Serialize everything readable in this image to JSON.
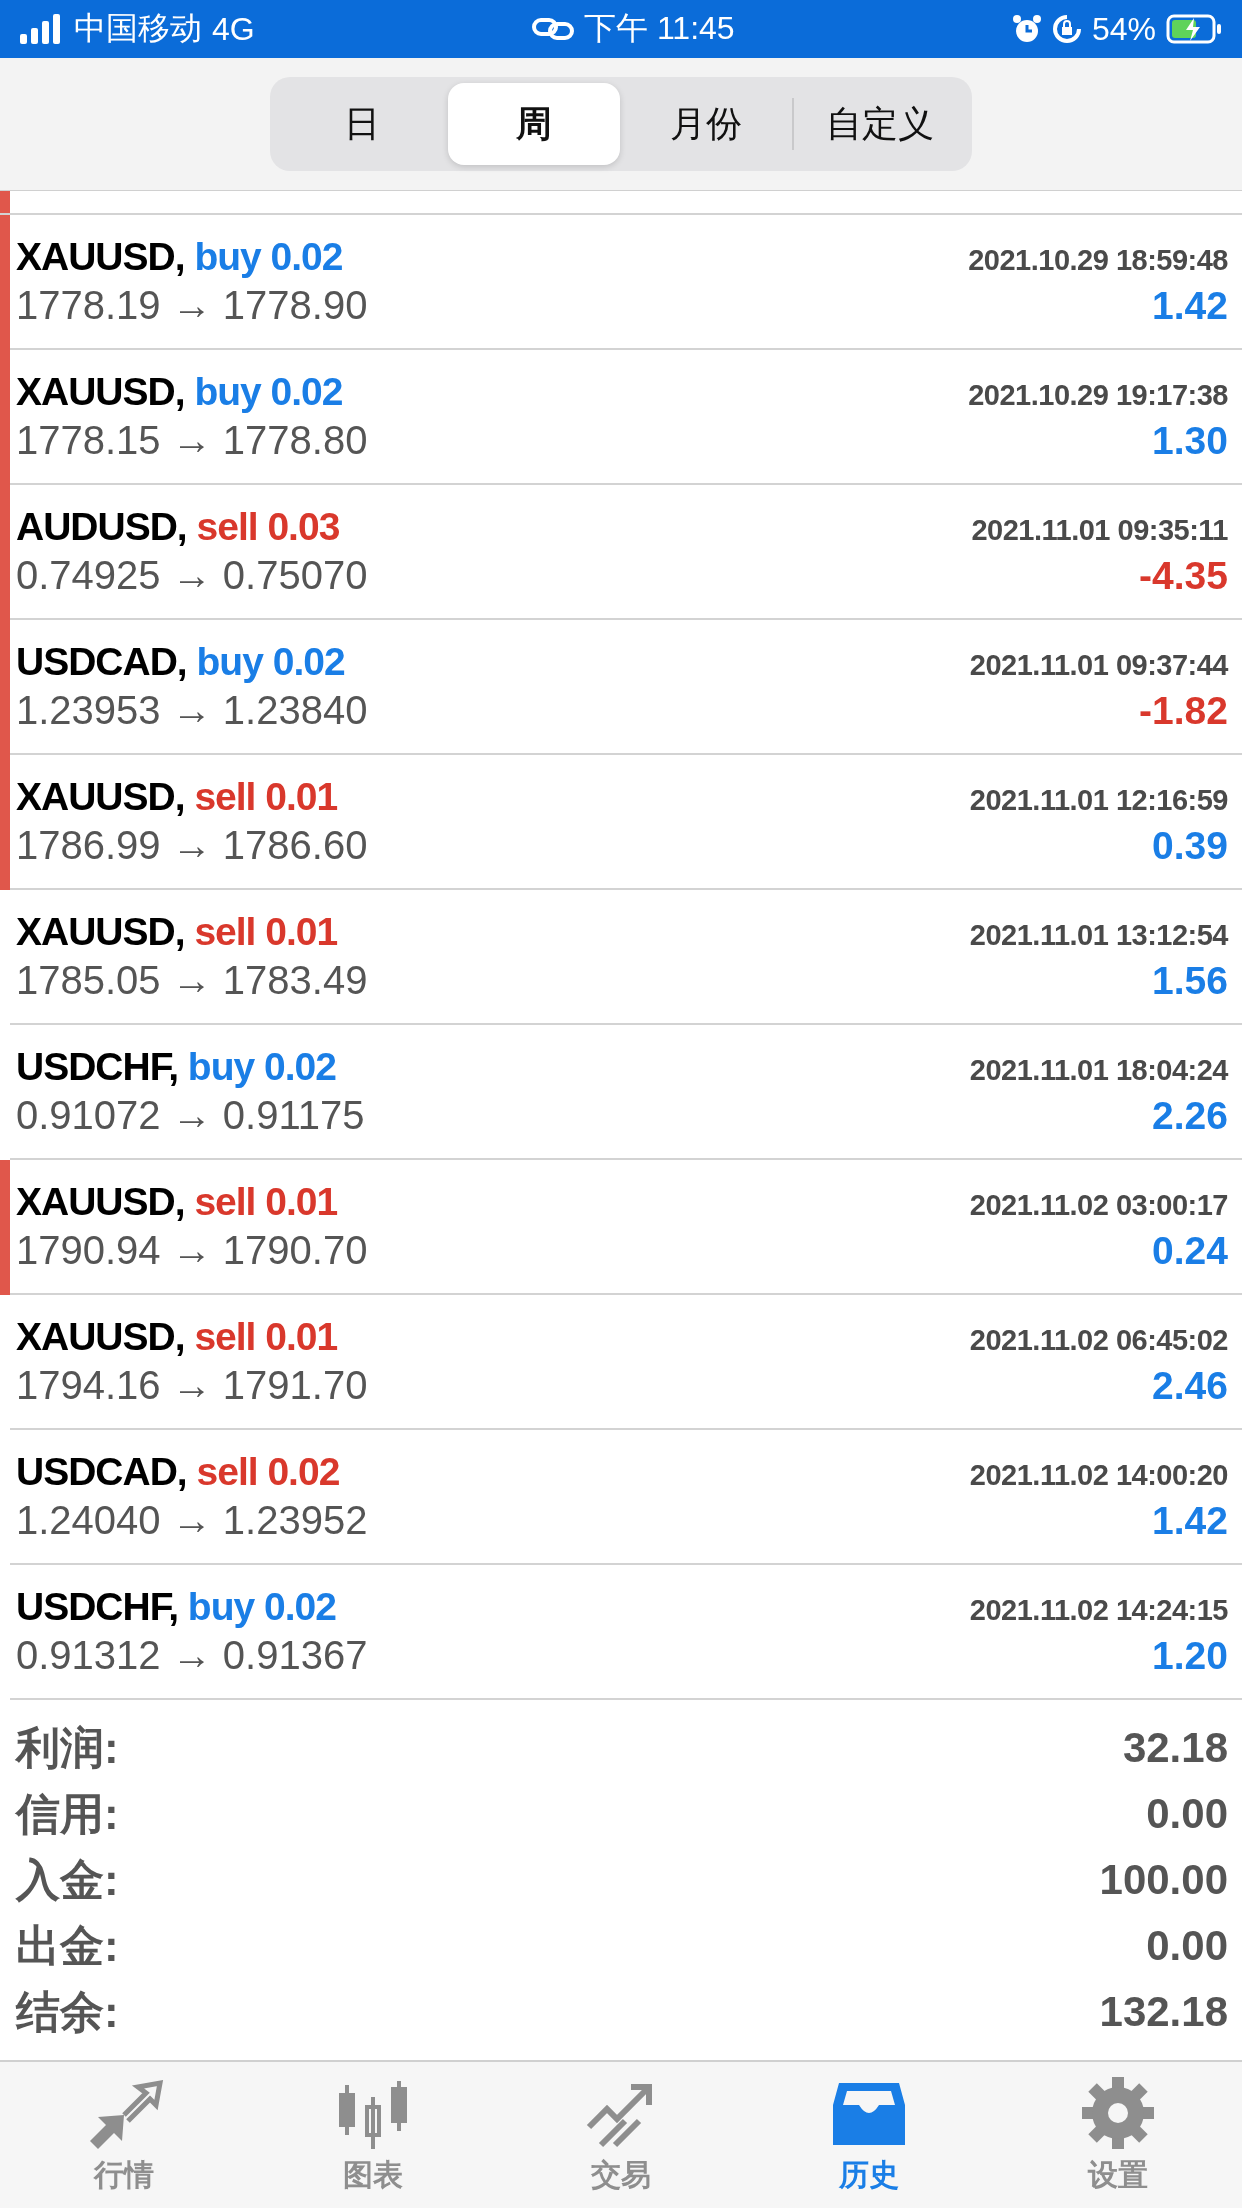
{
  "status_bar": {
    "carrier": "中国移动",
    "network": "4G",
    "time": "下午 11:45",
    "battery": "54%"
  },
  "period_tabs": [
    {
      "label": "日",
      "selected": false
    },
    {
      "label": "周",
      "selected": true
    },
    {
      "label": "月份",
      "selected": false
    },
    {
      "label": "自定义",
      "selected": false
    }
  ],
  "partial_row": {
    "marked": true
  },
  "trades": [
    {
      "symbol": "XAUUSD,",
      "side": {
        "text": "buy",
        "color": "#1a7ee6"
      },
      "volume": "0.02",
      "time": "2021.10.29 18:59:48",
      "prices": "1778.19 → 1778.90",
      "profit": {
        "text": "1.42",
        "color": "#1a7ee6"
      },
      "marked": true
    },
    {
      "symbol": "XAUUSD,",
      "side": {
        "text": "buy",
        "color": "#1a7ee6"
      },
      "volume": "0.02",
      "time": "2021.10.29 19:17:38",
      "prices": "1778.15 → 1778.80",
      "profit": {
        "text": "1.30",
        "color": "#1a7ee6"
      },
      "marked": true
    },
    {
      "symbol": "AUDUSD,",
      "side": {
        "text": "sell",
        "color": "#d9382c"
      },
      "volume": "0.03",
      "time": "2021.11.01 09:35:11",
      "prices": "0.74925 → 0.75070",
      "profit": {
        "text": "-4.35",
        "color": "#d9382c"
      },
      "marked": true
    },
    {
      "symbol": "USDCAD,",
      "side": {
        "text": "buy",
        "color": "#1a7ee6"
      },
      "volume": "0.02",
      "time": "2021.11.01 09:37:44",
      "prices": "1.23953 → 1.23840",
      "profit": {
        "text": "-1.82",
        "color": "#d9382c"
      },
      "marked": true
    },
    {
      "symbol": "XAUUSD,",
      "side": {
        "text": "sell",
        "color": "#d9382c"
      },
      "volume": "0.01",
      "time": "2021.11.01 12:16:59",
      "prices": "1786.99 → 1786.60",
      "profit": {
        "text": "0.39",
        "color": "#1a7ee6"
      },
      "marked": true
    },
    {
      "symbol": "XAUUSD,",
      "side": {
        "text": "sell",
        "color": "#d9382c"
      },
      "volume": "0.01",
      "time": "2021.11.01 13:12:54",
      "prices": "1785.05 → 1783.49",
      "profit": {
        "text": "1.56",
        "color": "#1a7ee6"
      },
      "marked": false
    },
    {
      "symbol": "USDCHF,",
      "side": {
        "text": "buy",
        "color": "#1a7ee6"
      },
      "volume": "0.02",
      "time": "2021.11.01 18:04:24",
      "prices": "0.91072 → 0.91175",
      "profit": {
        "text": "2.26",
        "color": "#1a7ee6"
      },
      "marked": false
    },
    {
      "symbol": "XAUUSD,",
      "side": {
        "text": "sell",
        "color": "#d9382c"
      },
      "volume": "0.01",
      "time": "2021.11.02 03:00:17",
      "prices": "1790.94 → 1790.70",
      "profit": {
        "text": "0.24",
        "color": "#1a7ee6"
      },
      "marked": true
    },
    {
      "symbol": "XAUUSD,",
      "side": {
        "text": "sell",
        "color": "#d9382c"
      },
      "volume": "0.01",
      "time": "2021.11.02 06:45:02",
      "prices": "1794.16 → 1791.70",
      "profit": {
        "text": "2.46",
        "color": "#1a7ee6"
      },
      "marked": false
    },
    {
      "symbol": "USDCAD,",
      "side": {
        "text": "sell",
        "color": "#d9382c"
      },
      "volume": "0.02",
      "time": "2021.11.02 14:00:20",
      "prices": "1.24040 → 1.23952",
      "profit": {
        "text": "1.42",
        "color": "#1a7ee6"
      },
      "marked": false
    },
    {
      "symbol": "USDCHF,",
      "side": {
        "text": "buy",
        "color": "#1a7ee6"
      },
      "volume": "0.02",
      "time": "2021.11.02 14:24:15",
      "prices": "0.91312 → 0.91367",
      "profit": {
        "text": "1.20",
        "color": "#1a7ee6"
      },
      "marked": false
    }
  ],
  "summary": [
    {
      "label": "利润:",
      "value": "32.18"
    },
    {
      "label": "信用:",
      "value": "0.00"
    },
    {
      "label": "入金:",
      "value": "100.00"
    },
    {
      "label": "出金:",
      "value": "0.00"
    },
    {
      "label": "结余:",
      "value": "132.18"
    }
  ],
  "tab_bar": [
    {
      "kind": "quotes",
      "label": "行情",
      "selected": false
    },
    {
      "kind": "chart",
      "label": "图表",
      "selected": false
    },
    {
      "kind": "trade",
      "label": "交易",
      "selected": false
    },
    {
      "kind": "history",
      "label": "历史",
      "selected": true
    },
    {
      "kind": "settings",
      "label": "设置",
      "selected": false
    }
  ]
}
